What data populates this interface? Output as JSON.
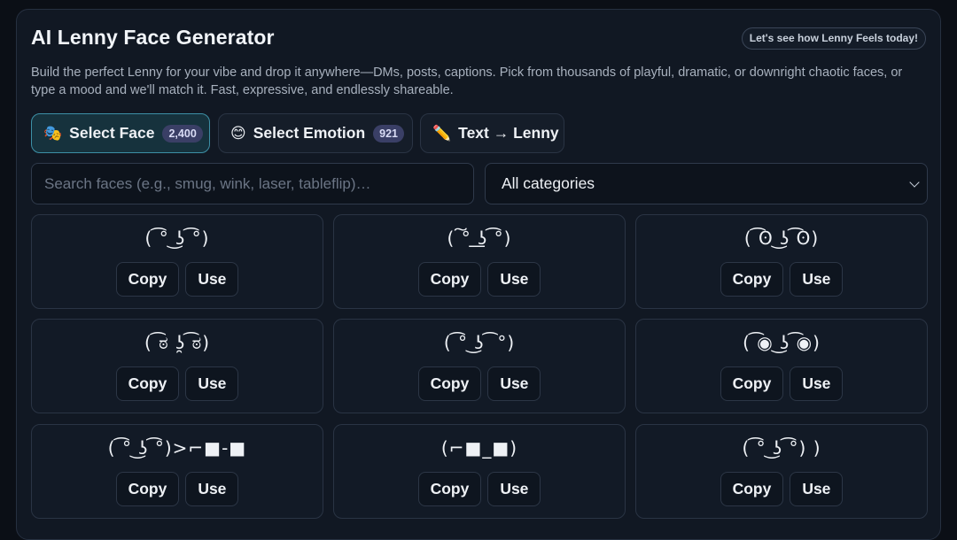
{
  "header": {
    "title": "AI Lenny Face Generator",
    "badge": "Let's see how Lenny Feels today!",
    "description": "Build the perfect Lenny for your vibe and drop it anywhere—DMs, posts, captions. Pick from thousands of playful, dramatic, or downright chaotic faces, or type a mood and we'll match it. Fast, expressive, and endlessly shareable."
  },
  "tabs": [
    {
      "icon": "🎭",
      "label": "Select Face",
      "count": "2,400",
      "active": true
    },
    {
      "icon": "😊",
      "label": "Select Emotion",
      "count": "921",
      "active": false
    },
    {
      "icon": "✏️",
      "label": "Text → Lenny",
      "count": "",
      "active": false
    }
  ],
  "search": {
    "placeholder": "Search faces (e.g., smug, wink, laser, tableflip)…",
    "value": ""
  },
  "category_select": {
    "selected": "All categories"
  },
  "card_actions": {
    "copy": "Copy",
    "use": "Use"
  },
  "faces": [
    "( ͡° ͜ʖ ͡°)",
    "( ͠° ͟ʖ ͡°)",
    "( ͡ʘ ͜ʖ ͡ʘ)",
    "( ͡ಠ ʖ̯ ͡ಠ)",
    "( ͡° ͜ʖ ͡ °)",
    "( ͡◉ ͜ʖ ͡◉)",
    "( ͡° ͜ʖ ͡°)>⌐■-■",
    "(⌐■_■)",
    "( ͡° ͜ʖ ͡°) )"
  ]
}
